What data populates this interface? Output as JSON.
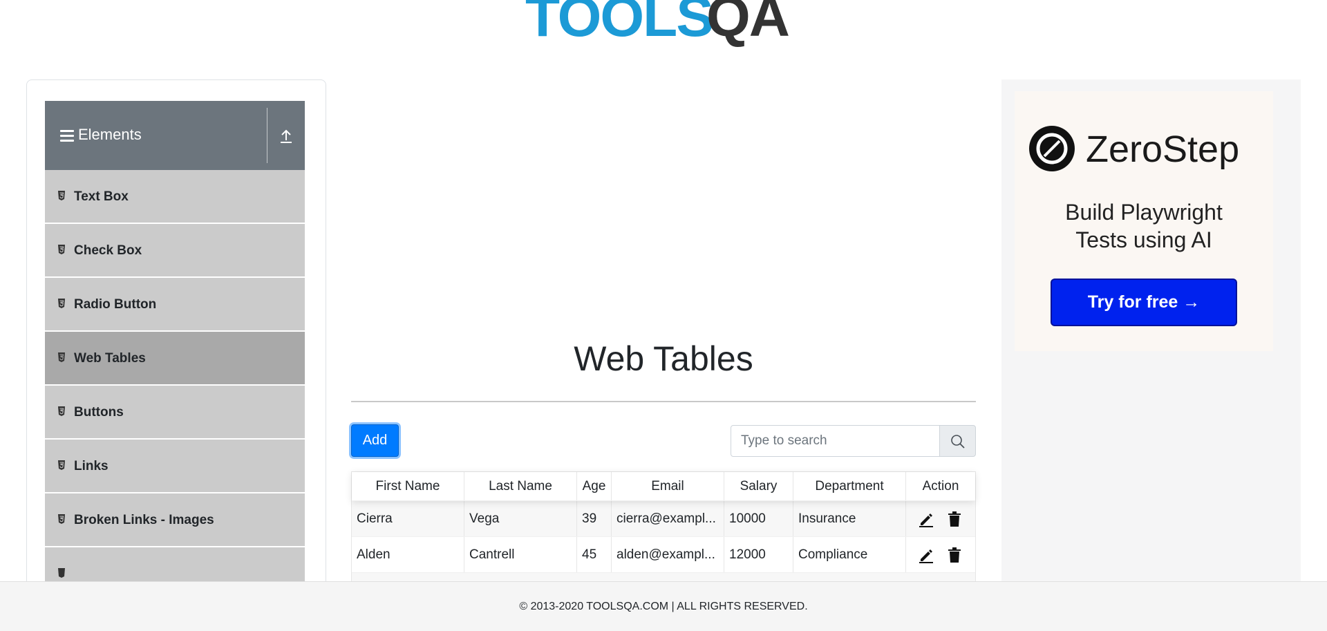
{
  "header": {
    "logo_text_tools": "TOOLS",
    "logo_text_qa": "QA"
  },
  "sidebar": {
    "group_title": "Elements",
    "items": [
      {
        "label": "Text Box",
        "active": false
      },
      {
        "label": "Check Box",
        "active": false
      },
      {
        "label": "Radio Button",
        "active": false
      },
      {
        "label": "Web Tables",
        "active": true
      },
      {
        "label": "Buttons",
        "active": false
      },
      {
        "label": "Links",
        "active": false
      },
      {
        "label": "Broken Links - Images",
        "active": false
      }
    ]
  },
  "main": {
    "title": "Web Tables",
    "add_label": "Add",
    "search_placeholder": "Type to search",
    "table": {
      "columns": [
        "First Name",
        "Last Name",
        "Age",
        "Email",
        "Salary",
        "Department",
        "Action"
      ],
      "rows": [
        [
          "Cierra",
          "Vega",
          "39",
          "cierra@exampl...",
          "10000",
          "Insurance"
        ],
        [
          "Alden",
          "Cantrell",
          "45",
          "alden@exampl...",
          "12000",
          "Compliance"
        ]
      ]
    }
  },
  "ad": {
    "brand": "ZeroStep",
    "tagline_line1": "Build Playwright",
    "tagline_line2": "Tests using AI",
    "cta_label": "Try for free →",
    "cta_color": "#0022ee"
  },
  "footer": {
    "text": "© 2013-2020 TOOLSQA.COM | ALL RIGHTS RESERVED."
  },
  "colors": {
    "accent": "#007bff",
    "sidebar_header": "#6c757d",
    "sidebar_item": "#cbcbcb",
    "sidebar_item_active": "#a9a9a9",
    "logo_blue": "#1c9ad6"
  }
}
